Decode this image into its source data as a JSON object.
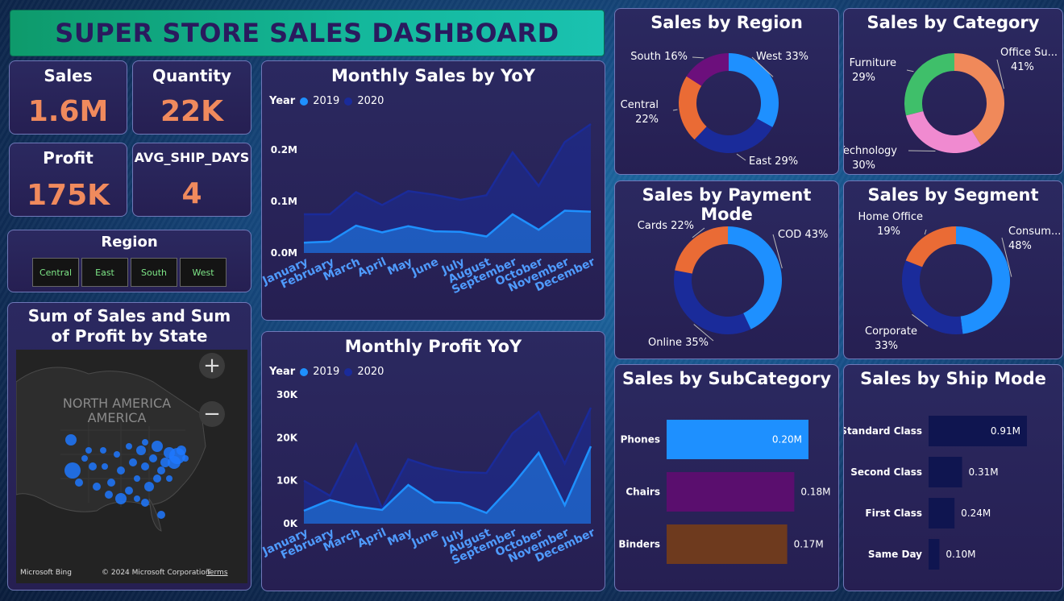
{
  "header": {
    "title": "SUPER STORE SALES DASHBOARD"
  },
  "kpis": {
    "sales": {
      "label": "Sales",
      "value": "1.6M"
    },
    "quantity": {
      "label": "Quantity",
      "value": "22K"
    },
    "profit": {
      "label": "Profit",
      "value": "175K"
    },
    "ship_days": {
      "label": "AVG_SHIP_DAYS",
      "value": "4"
    }
  },
  "region_slicer": {
    "title": "Region",
    "options": [
      "Central",
      "East",
      "South",
      "West"
    ]
  },
  "map": {
    "title": "Sum of Sales and Sum of Profit by State",
    "label": "NORTH AMERICA",
    "zoom_in_icon": "plus-icon",
    "zoom_out_icon": "minus-icon",
    "brand": "Microsoft Bing",
    "copyright": "© 2024 Microsoft Corporation",
    "terms": "Terms"
  },
  "legend": {
    "title": "Year",
    "series": [
      "2019",
      "2020"
    ]
  },
  "colors": {
    "series_2019": "#1e90ff",
    "series_2020": "#1a2b9a",
    "accent_kpi": "#f08a5d",
    "title_bar": "#14b89c",
    "title_text": "#2a1a5e"
  },
  "chart_data": [
    {
      "id": "monthly_sales",
      "type": "area",
      "title": "Monthly Sales by YoY",
      "categories": [
        "January",
        "February",
        "March",
        "April",
        "May",
        "June",
        "July",
        "August",
        "September",
        "October",
        "November",
        "December"
      ],
      "yticks": [
        "0.0M",
        "0.1M",
        "0.2M"
      ],
      "ylim": [
        0,
        0.25
      ],
      "series": [
        {
          "name": "2019",
          "values": [
            0.02,
            0.022,
            0.053,
            0.04,
            0.052,
            0.042,
            0.041,
            0.032,
            0.075,
            0.045,
            0.082,
            0.08
          ]
        },
        {
          "name": "2020",
          "values": [
            0.075,
            0.075,
            0.118,
            0.093,
            0.12,
            0.113,
            0.103,
            0.112,
            0.195,
            0.13,
            0.215,
            0.25
          ]
        }
      ]
    },
    {
      "id": "monthly_profit",
      "type": "area",
      "title": "Monthly Profit YoY",
      "categories": [
        "January",
        "February",
        "March",
        "April",
        "May",
        "June",
        "July",
        "August",
        "September",
        "October",
        "November",
        "December"
      ],
      "yticks": [
        "0K",
        "10K",
        "20K",
        "30K"
      ],
      "ylim": [
        0,
        30000
      ],
      "series": [
        {
          "name": "2019",
          "values": [
            3000,
            5500,
            4000,
            3200,
            9000,
            5000,
            4800,
            2500,
            9000,
            16500,
            4300,
            18000
          ]
        },
        {
          "name": "2020",
          "values": [
            10000,
            6500,
            18500,
            3500,
            15000,
            13000,
            12000,
            11800,
            21000,
            26000,
            14000,
            27000
          ]
        }
      ]
    },
    {
      "id": "region",
      "type": "pie",
      "title": "Sales by Region",
      "labels": [
        "West 33%",
        "East 29%",
        "Central 22%",
        "South 16%"
      ],
      "values": [
        33,
        29,
        22,
        16
      ],
      "colors": [
        "#1e90ff",
        "#1a2b9a",
        "#ea6b35",
        "#6c0f7c"
      ]
    },
    {
      "id": "category",
      "type": "pie",
      "title": "Sales by Category",
      "labels": [
        "Office Su... 41%",
        "Technology 30%",
        "Furniture 29%"
      ],
      "values": [
        41,
        30,
        29
      ],
      "colors": [
        "#f0895a",
        "#f08ad0",
        "#3fbf6a"
      ]
    },
    {
      "id": "payment",
      "type": "pie",
      "title": "Sales by Payment Mode",
      "labels": [
        "COD 43%",
        "Online 35%",
        "Cards 22%"
      ],
      "values": [
        43,
        35,
        22
      ],
      "colors": [
        "#1e90ff",
        "#1a2b9a",
        "#ea6b35"
      ]
    },
    {
      "id": "segment",
      "type": "pie",
      "title": "Sales by Segment",
      "labels": [
        "Consum... 48%",
        "Corporate 33%",
        "Home Office 19%"
      ],
      "values": [
        48,
        33,
        19
      ],
      "colors": [
        "#1e90ff",
        "#1a2b9a",
        "#ea6b35"
      ]
    },
    {
      "id": "subcategory",
      "type": "bar",
      "title": "Sales by SubCategory",
      "categories": [
        "Phones",
        "Chairs",
        "Binders"
      ],
      "values": [
        0.2,
        0.18,
        0.17
      ],
      "value_labels": [
        "0.20M",
        "0.18M",
        "0.17M"
      ],
      "colors": [
        "#1e90ff",
        "#5a0e6e",
        "#6e3a1e"
      ]
    },
    {
      "id": "shipmode",
      "type": "bar",
      "title": "Sales by Ship Mode",
      "categories": [
        "Standard Class",
        "Second Class",
        "First Class",
        "Same Day"
      ],
      "values": [
        0.91,
        0.31,
        0.24,
        0.1
      ],
      "value_labels": [
        "0.91M",
        "0.31M",
        "0.24M",
        "0.10M"
      ],
      "colors": [
        "#0f1550",
        "#0f1550",
        "#0f1550",
        "#0f1550"
      ]
    }
  ]
}
